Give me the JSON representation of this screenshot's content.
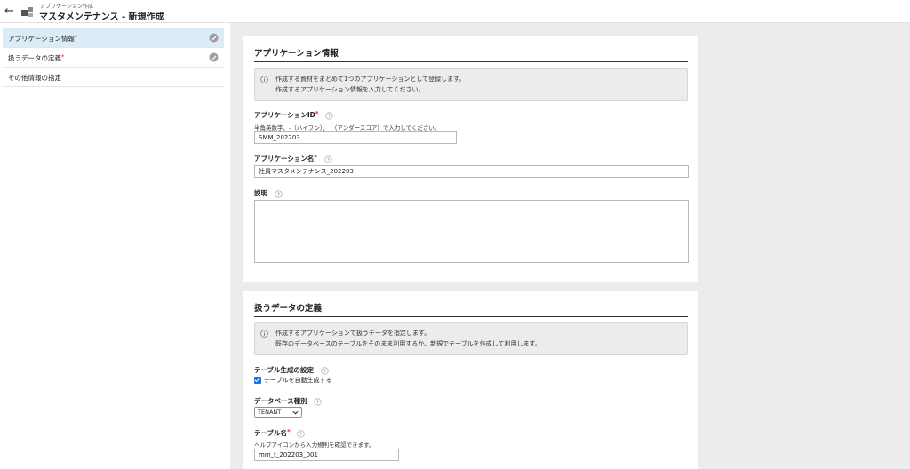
{
  "header": {
    "subtitle": "アプリケーション作成",
    "title": "マスタメンテナンス - 新規作成"
  },
  "sidebar": {
    "items": [
      {
        "label": "アプリケーション情報",
        "required": "*",
        "completed": true,
        "active": true
      },
      {
        "label": "扱うデータの定義",
        "required": "*",
        "completed": true,
        "active": false
      },
      {
        "label": "その他情報の指定",
        "required": "",
        "completed": false,
        "active": false
      }
    ]
  },
  "app_info": {
    "title": "アプリケーション情報",
    "info_lines": [
      "作成する資材をまとめて1つのアプリケーションとして登録します。",
      "作成するアプリケーション情報を入力してください。"
    ],
    "app_id": {
      "label": "アプリケーションID",
      "required": "*",
      "hint": "半角英数字、-（ハイフン）、_（アンダースコア）で入力してください。",
      "value": "SMM_202203"
    },
    "app_name": {
      "label": "アプリケーション名",
      "required": "*",
      "value": "社員マスタメンテナンス_202203"
    },
    "description": {
      "label": "説明",
      "value": ""
    }
  },
  "data_def": {
    "title": "扱うデータの定義",
    "info_lines": [
      "作成するアプリケーションで扱うデータを指定します。",
      "既存のデータベースのテーブルをそのまま利用するか、新規でテーブルを作成して利用します。"
    ],
    "table_gen": {
      "label": "テーブル生成の設定",
      "checkbox_label": "テーブルを自動生成する",
      "checked": true
    },
    "db_type": {
      "label": "データベース種別",
      "selected": "TENANT"
    },
    "table_name": {
      "label": "テーブル名",
      "required": "*",
      "hint": "ヘルプアイコンから入力規則を確認できます。",
      "value": "mm_t_202203_001"
    }
  },
  "colors": {
    "accent": "#1a73e8",
    "active_nav": "#dcecf7",
    "required": "#dd2233",
    "background": "#ececec"
  }
}
